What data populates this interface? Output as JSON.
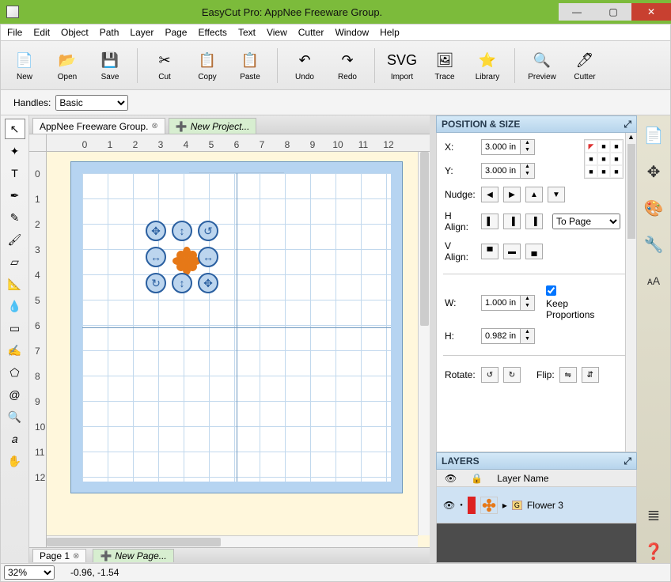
{
  "title": "EasyCut Pro: AppNee Freeware Group.",
  "menus": [
    "File",
    "Edit",
    "Object",
    "Path",
    "Layer",
    "Page",
    "Effects",
    "Text",
    "View",
    "Cutter",
    "Window",
    "Help"
  ],
  "toolbar": [
    {
      "label": "New",
      "icon": "📄"
    },
    {
      "label": "Open",
      "icon": "📂"
    },
    {
      "label": "Save",
      "icon": "💾"
    },
    {
      "sep": true
    },
    {
      "label": "Cut",
      "icon": "✂"
    },
    {
      "label": "Copy",
      "icon": "📋"
    },
    {
      "label": "Paste",
      "icon": "📋"
    },
    {
      "sep": true
    },
    {
      "label": "Undo",
      "icon": "↶"
    },
    {
      "label": "Redo",
      "icon": "↷"
    },
    {
      "sep": true
    },
    {
      "label": "Import",
      "icon": "SVG"
    },
    {
      "label": "Trace",
      "icon": "🖼"
    },
    {
      "label": "Library",
      "icon": "⭐"
    },
    {
      "sep": true
    },
    {
      "label": "Preview",
      "icon": "🔍"
    },
    {
      "label": "Cutter",
      "icon": "🖊"
    }
  ],
  "options": {
    "handles_label": "Handles:",
    "handles_value": "Basic"
  },
  "left_tools": [
    "arrow",
    "node",
    "type",
    "pen",
    "pencil",
    "brush",
    "eraser",
    "measure",
    "dropper",
    "rect",
    "draw",
    "poly",
    "spiral",
    "zoom",
    "text",
    "hand"
  ],
  "tabs": [
    {
      "label": "AppNee Freeware Group.",
      "active": true,
      "closeable": true
    },
    {
      "label": "New Project...",
      "new": true
    }
  ],
  "ruler_h": [
    0,
    1,
    2,
    3,
    4,
    5,
    6,
    7,
    8,
    9,
    10,
    11,
    12
  ],
  "ruler_v": [
    0,
    1,
    2,
    3,
    4,
    5,
    6,
    7,
    8,
    9,
    10,
    11,
    12
  ],
  "position_size": {
    "title": "POSITION & SIZE",
    "x_label": "X:",
    "x": "3.000 in",
    "y_label": "Y:",
    "y": "3.000 in",
    "nudge_label": "Nudge:",
    "halign_label": "H Align:",
    "valign_label": "V Align:",
    "align_ref": "To Page",
    "w_label": "W:",
    "w": "1.000 in",
    "h_label": "H:",
    "h": "0.982 in",
    "keep_prop": "Keep Proportions",
    "rotate_label": "Rotate:",
    "flip_label": "Flip:"
  },
  "layers": {
    "title": "LAYERS",
    "col": "Layer Name",
    "item_name": "Flower 3"
  },
  "page_footer": {
    "page_tab": "Page 1",
    "new_page": "New Page..."
  },
  "status": {
    "zoom": "32%",
    "coords": "-0.96, -1.54"
  }
}
